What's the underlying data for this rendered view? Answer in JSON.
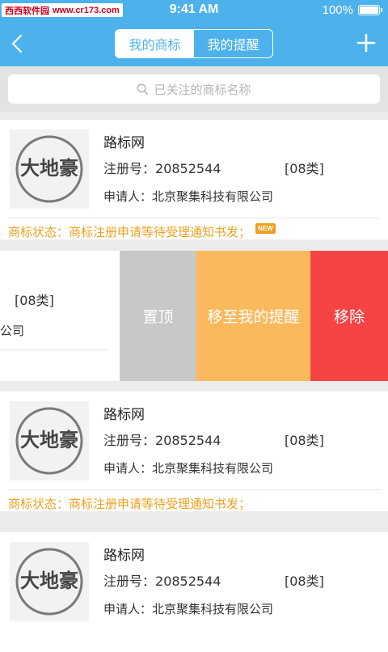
{
  "status_bar": {
    "watermark_site": "西西软件园",
    "watermark_url": "www.cr173.com",
    "time": "9:41 AM",
    "battery": "100%"
  },
  "nav": {
    "segments": [
      {
        "label": "我的商标",
        "active": true
      },
      {
        "label": "我的提醒",
        "active": false
      }
    ]
  },
  "search": {
    "placeholder": "已关注的商标名称"
  },
  "cards": [
    {
      "name": "路标网",
      "reg_label": "注册号：",
      "reg_no": "20852544",
      "class": "[08类]",
      "applicant_label": "申请人：",
      "applicant": "北京聚集科技有限公司",
      "status_label": "商标状态：",
      "status": "商标注册申请等待受理通知书发；",
      "badge": "NEW"
    },
    {
      "name": "路标网",
      "reg_label": "注册号：",
      "reg_no": "20852544",
      "class": "[08类]",
      "applicant_label": "申请人：",
      "applicant": "北京聚集科技有限公司",
      "status_label": "商标状态：",
      "status": "商标注册申请等待受理通知书发；"
    },
    {
      "name": "路标网",
      "reg_label": "注册号：",
      "reg_no": "20852544",
      "class": "[08类]",
      "applicant_label": "申请人：",
      "applicant": "北京聚集科技有限公司"
    }
  ],
  "swipe_row": {
    "class": "[08类]",
    "company_tail": "公司",
    "actions": [
      "置顶",
      "移至我的提醒",
      "移除"
    ]
  },
  "logo_text": "大地豪",
  "colors": {
    "primary": "#4db2ec",
    "status_orange": "#f0a020",
    "pin_gray": "#c8c8c8",
    "move_orange": "#fbb95d",
    "remove_red": "#f74343"
  },
  "icons": [
    "back-arrow-icon",
    "plus-icon",
    "search-icon"
  ]
}
